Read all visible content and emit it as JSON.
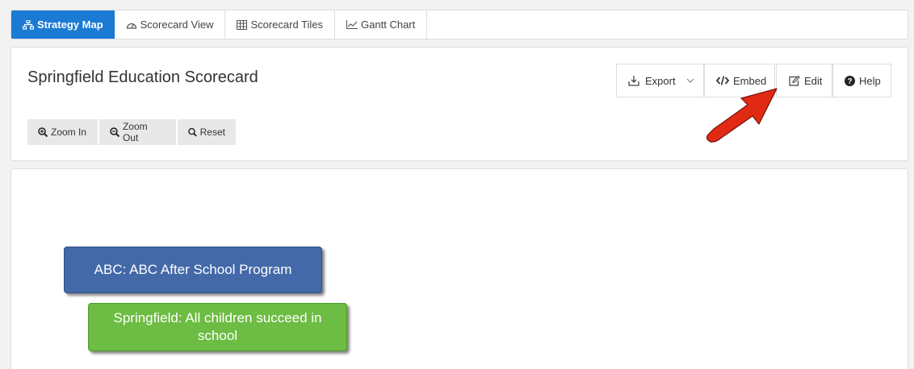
{
  "tabs": [
    {
      "label": "Strategy Map",
      "icon": "sitemap-icon",
      "active": true
    },
    {
      "label": "Scorecard View",
      "icon": "dashboard-icon",
      "active": false
    },
    {
      "label": "Scorecard Tiles",
      "icon": "grid-icon",
      "active": false
    },
    {
      "label": "Gantt Chart",
      "icon": "line-chart-icon",
      "active": false
    }
  ],
  "header": {
    "title": "Springfield Education Scorecard",
    "export_label": "Export",
    "embed_label": "Embed",
    "edit_label": "Edit",
    "help_label": "Help"
  },
  "zoom": {
    "zoom_in_label": "Zoom In",
    "zoom_out_label": "Zoom Out",
    "reset_label": "Reset"
  },
  "map": {
    "nodes": [
      {
        "label": "ABC: ABC After School Program",
        "color": "#4369a9"
      },
      {
        "label": "Springfield: All children succeed in school",
        "color": "#6dbc43"
      }
    ]
  },
  "colors": {
    "accent": "#1a7ad4",
    "annotation_arrow": "#e02a14"
  }
}
